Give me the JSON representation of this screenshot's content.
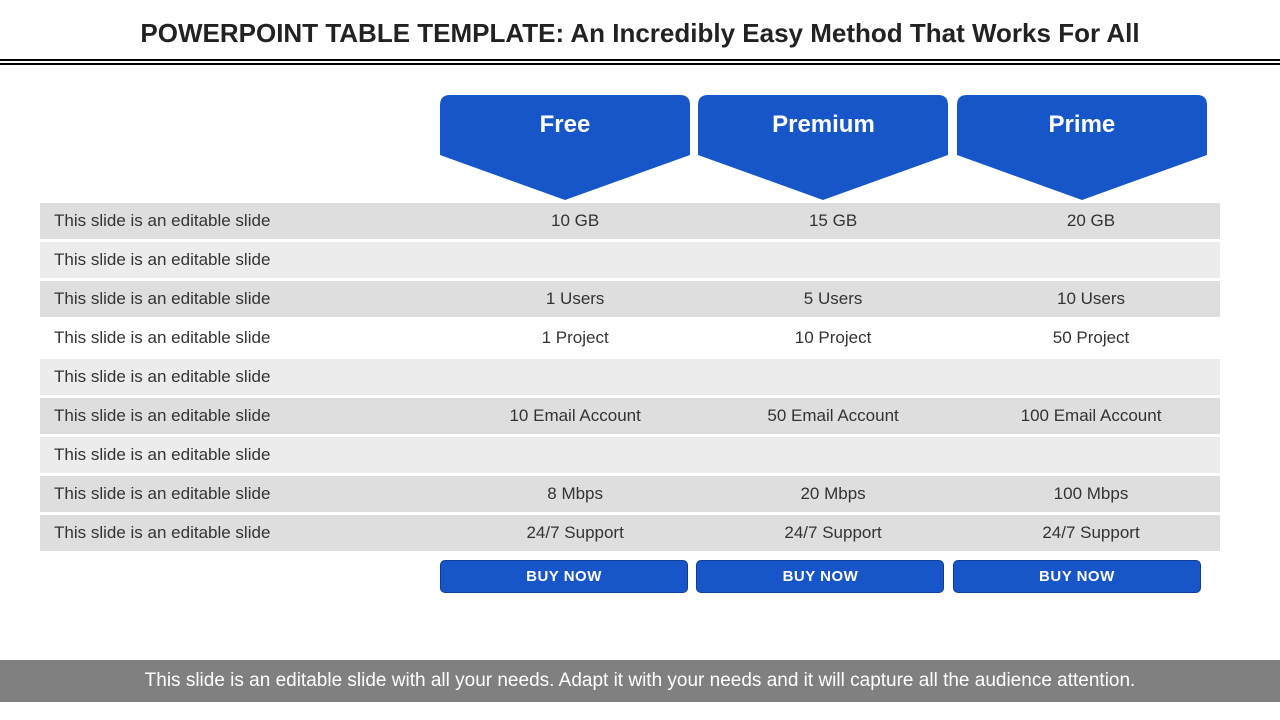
{
  "title": "POWERPOINT TABLE TEMPLATE: An Incredibly Easy Method That Works For All",
  "colors": {
    "accent": "#1756c9"
  },
  "plans": [
    {
      "name": "Free"
    },
    {
      "name": "Premium"
    },
    {
      "name": "Prime"
    }
  ],
  "rows": [
    {
      "label": "This slide is an editable slide",
      "free": "10 GB",
      "premium": "15 GB",
      "prime": "20 GB",
      "tone": "shade"
    },
    {
      "label": "This slide is an editable slide",
      "free": "",
      "premium": "",
      "prime": "",
      "tone": "pale"
    },
    {
      "label": "This slide is an editable slide",
      "free": "1 Users",
      "premium": "5 Users",
      "prime": "10 Users",
      "tone": "shade"
    },
    {
      "label": "This slide is an editable slide",
      "free": "1 Project",
      "premium": "10 Project",
      "prime": "50 Project",
      "tone": "light"
    },
    {
      "label": "This slide is an editable slide",
      "free": "",
      "premium": "",
      "prime": "",
      "tone": "pale"
    },
    {
      "label": "This slide is an editable slide",
      "free": "10 Email Account",
      "premium": "50 Email Account",
      "prime": "100 Email Account",
      "tone": "shade"
    },
    {
      "label": "This slide is an editable slide",
      "free": "",
      "premium": "",
      "prime": "",
      "tone": "pale"
    },
    {
      "label": "This slide is an editable slide",
      "free": "8 Mbps",
      "premium": "20 Mbps",
      "prime": "100 Mbps",
      "tone": "shade"
    },
    {
      "label": "This slide is an editable slide",
      "free": "24/7 Support",
      "premium": "24/7 Support",
      "prime": "24/7 Support",
      "tone": "shade"
    }
  ],
  "buy_label": "BUY NOW",
  "footer": "This slide is an editable slide with all your needs. Adapt it with your needs and it will capture all the audience attention."
}
